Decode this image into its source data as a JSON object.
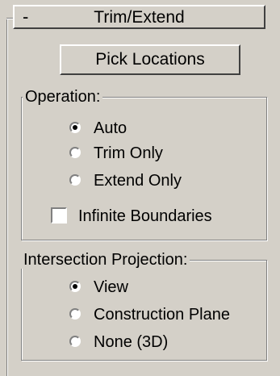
{
  "rollout": {
    "collapse_symbol": "-",
    "title": "Trim/Extend",
    "pick_button_label": "Pick Locations"
  },
  "operation": {
    "group_label": "Operation:",
    "options": [
      {
        "label": "Auto",
        "selected": true
      },
      {
        "label": "Trim Only",
        "selected": false
      },
      {
        "label": "Extend Only",
        "selected": false
      }
    ],
    "infinite_boundaries": {
      "label": "Infinite Boundaries",
      "checked": false
    }
  },
  "intersection_projection": {
    "group_label": "Intersection Projection:",
    "options": [
      {
        "label": "View",
        "selected": true
      },
      {
        "label": "Construction Plane",
        "selected": false
      },
      {
        "label": "None (3D)",
        "selected": false
      }
    ]
  }
}
